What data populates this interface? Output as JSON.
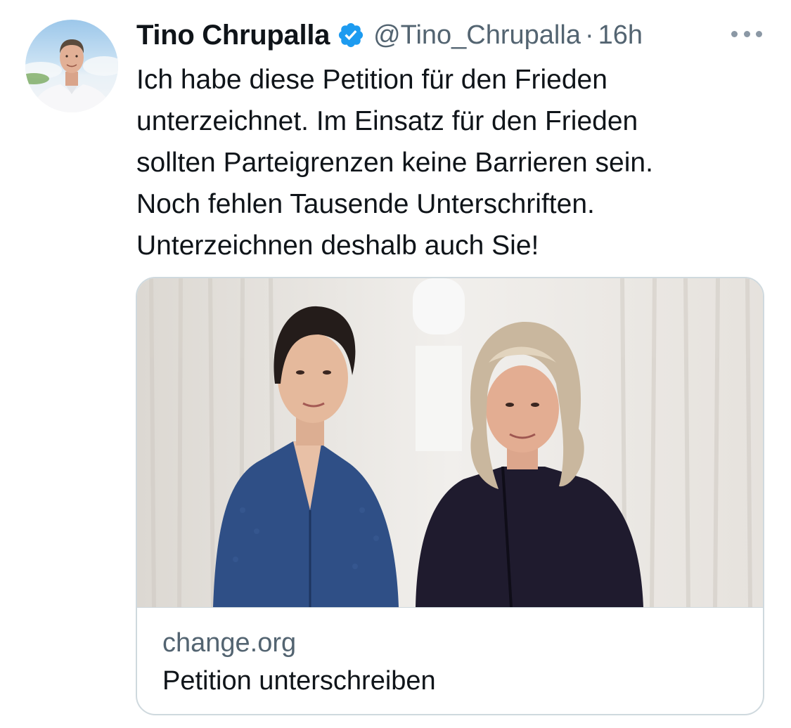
{
  "tweet": {
    "author": {
      "display_name": "Tino Chrupalla",
      "handle": "@Tino_Chrupalla",
      "verified_icon": "verified-badge-icon"
    },
    "separator": "·",
    "time": "16h",
    "more_icon": "more-horizontal-icon",
    "text_lines": [
      "Ich habe diese Petition für den Frieden",
      "unterzeichnet. Im Einsatz für den Frieden",
      "sollten Parteigrenzen keine Barrieren sein.",
      "Noch fehlen Tausende Unterschriften.",
      "Unterzeichnen deshalb auch Sie!"
    ],
    "card": {
      "domain": "change.org",
      "title": "Petition unterschreiben"
    }
  },
  "colors": {
    "text_primary": "#0f1419",
    "text_secondary": "#536471",
    "verified_blue": "#1d9bf0",
    "card_border": "#cfd9de"
  }
}
